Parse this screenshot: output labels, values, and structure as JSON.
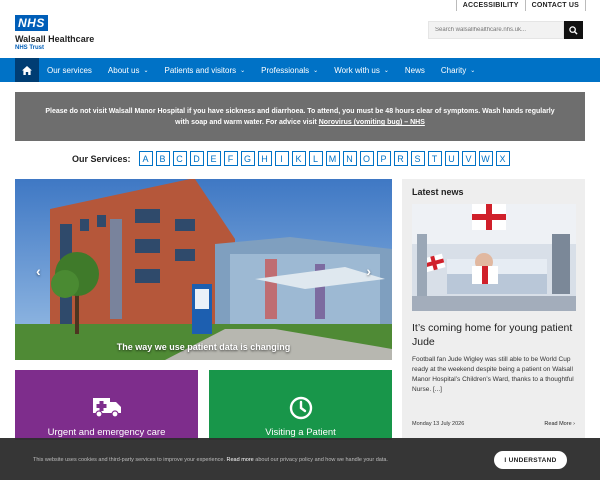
{
  "header": {
    "nhs_badge": "NHS",
    "org_name": "Walsall Healthcare",
    "org_sub": "NHS Trust",
    "utility_links": [
      "ACCESSIBILITY",
      "CONTACT US"
    ],
    "search_placeholder": "Search walsallhealthcare.nhs.uk..."
  },
  "nav": {
    "items": [
      {
        "label": "Our services",
        "dropdown": false
      },
      {
        "label": "About us",
        "dropdown": true
      },
      {
        "label": "Patients and visitors",
        "dropdown": true
      },
      {
        "label": "Professionals",
        "dropdown": true
      },
      {
        "label": "Work with us",
        "dropdown": true
      },
      {
        "label": "News",
        "dropdown": false
      },
      {
        "label": "Charity",
        "dropdown": true
      }
    ]
  },
  "alert": {
    "text": "Please do not visit Walsall Manor Hospital if you have sickness and diarrhoea. To attend, you must be 48 hours clear of symptoms. Wash hands regularly with soap and warm water. For advice visit ",
    "link": "Norovirus (vomiting bug) – NHS"
  },
  "services": {
    "label": "Our Services:",
    "letters": [
      "A",
      "B",
      "C",
      "D",
      "E",
      "F",
      "G",
      "H",
      "I",
      "K",
      "L",
      "M",
      "N",
      "O",
      "P",
      "R",
      "S",
      "T",
      "U",
      "V",
      "W",
      "X"
    ]
  },
  "hero": {
    "caption": "The way we use patient data is changing",
    "prev": "‹",
    "next": "›"
  },
  "news": {
    "heading": "Latest news",
    "title": "It’s coming home for young patient Jude",
    "text": "Football fan Jude Wigley was still able to be World Cup ready at the weekend despite being a patient on Walsall Manor Hospital’s Children’s Ward, thanks to a thoughtful Nurse. [...]",
    "date": "Monday 13 July 2026",
    "more": "Read More ›"
  },
  "tiles": [
    {
      "label": "Urgent and emergency care",
      "icon": "ambulance-icon",
      "color": "#7e2d8c"
    },
    {
      "label": "Visiting a Patient",
      "icon": "clock-icon",
      "color": "#18964a"
    }
  ],
  "cookie": {
    "text_before": "This website uses cookies and third-party services to improve your experience. ",
    "read_more": "Read more",
    "text_after": " about our privacy policy and how we handle your data.",
    "button": "I UNDERSTAND"
  },
  "colors": {
    "nhs_blue": "#005eb8",
    "nav_blue": "#0072c6",
    "alert_grey": "#6e6e6e"
  }
}
